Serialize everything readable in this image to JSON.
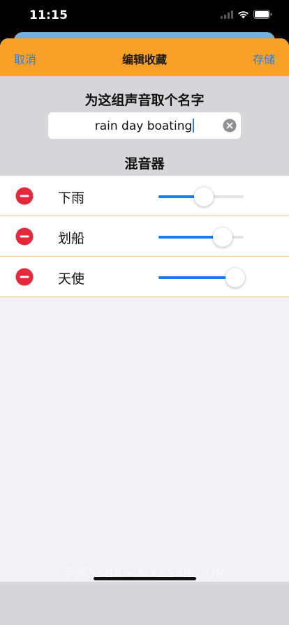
{
  "status_bar": {
    "time": "11:15",
    "icons": [
      "signal-icon",
      "wifi-icon",
      "battery-icon"
    ]
  },
  "nav": {
    "cancel_label": "取消",
    "title": "编辑收藏",
    "save_label": "存储"
  },
  "form": {
    "name_prompt": "为这组声音取个名字",
    "name_value": "rain day boating",
    "clear_icon": "clear-icon"
  },
  "mixer": {
    "title": "混音器",
    "rows": [
      {
        "label": "下雨",
        "volume": 0.53
      },
      {
        "label": "划船",
        "volume": 0.75
      },
      {
        "label": "天使",
        "volume": 0.9
      }
    ]
  },
  "watermark": "手游5588 • MX5588.COM",
  "colors": {
    "nav_background": "#f9a126",
    "accent_blue": "#2f7fe0",
    "slider_fill": "#1a7cf0",
    "delete_red": "#e5293d",
    "row_divider": "#f5c782"
  }
}
